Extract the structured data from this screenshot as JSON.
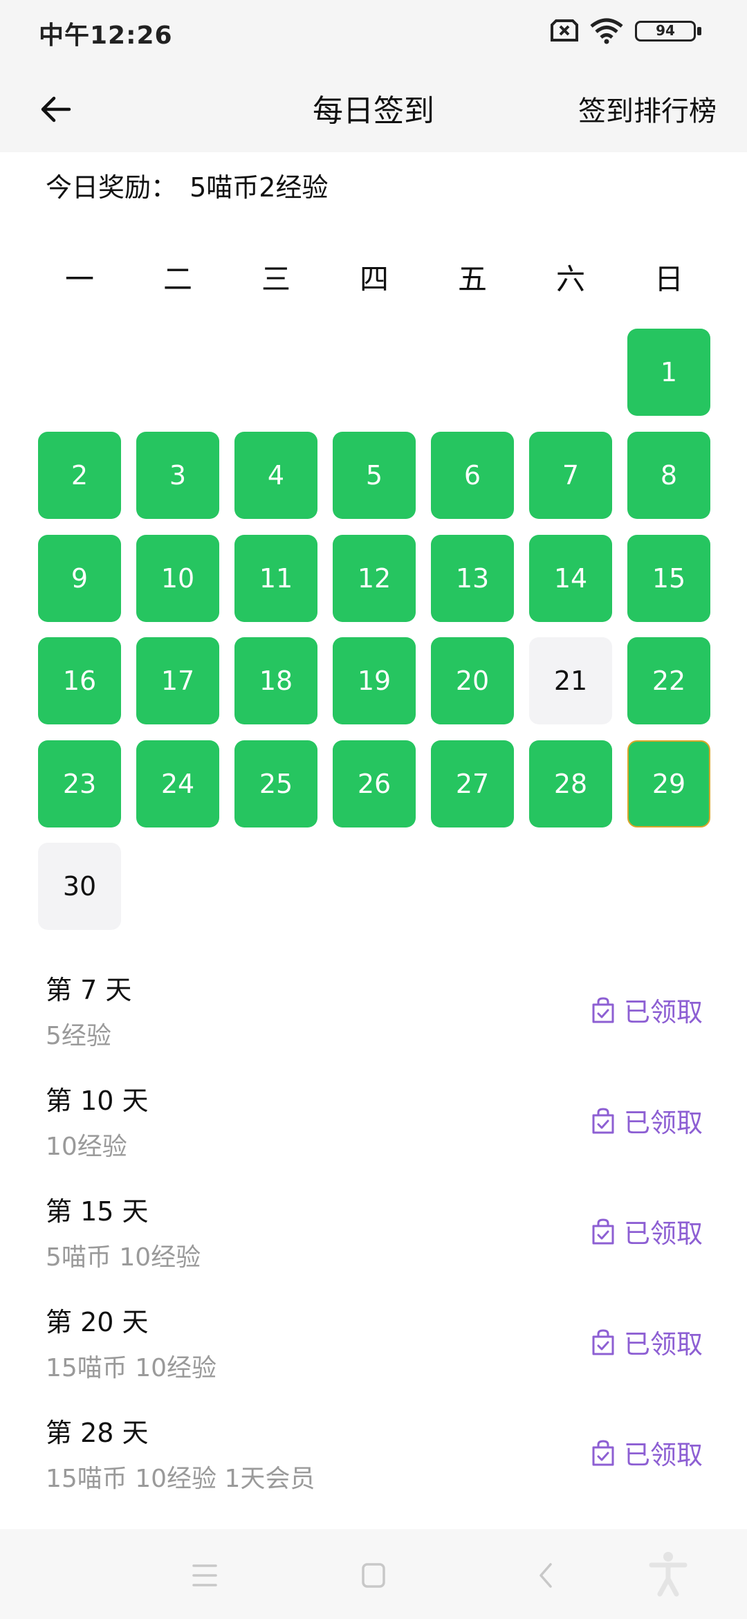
{
  "status_bar": {
    "time": "中午12:26",
    "battery": "94"
  },
  "header": {
    "title": "每日签到",
    "rank_link": "签到排行榜"
  },
  "reward": {
    "label": "今日奖励：",
    "value": "5喵币2经验"
  },
  "weekdays": [
    "一",
    "二",
    "三",
    "四",
    "五",
    "六",
    "日"
  ],
  "calendar": {
    "days": [
      {
        "n": "1",
        "signed": true
      },
      {
        "n": "2",
        "signed": true
      },
      {
        "n": "3",
        "signed": true
      },
      {
        "n": "4",
        "signed": true
      },
      {
        "n": "5",
        "signed": true
      },
      {
        "n": "6",
        "signed": true
      },
      {
        "n": "7",
        "signed": true
      },
      {
        "n": "8",
        "signed": true
      },
      {
        "n": "9",
        "signed": true
      },
      {
        "n": "10",
        "signed": true
      },
      {
        "n": "11",
        "signed": true
      },
      {
        "n": "12",
        "signed": true
      },
      {
        "n": "13",
        "signed": true
      },
      {
        "n": "14",
        "signed": true
      },
      {
        "n": "15",
        "signed": true
      },
      {
        "n": "16",
        "signed": true
      },
      {
        "n": "17",
        "signed": true
      },
      {
        "n": "18",
        "signed": true
      },
      {
        "n": "19",
        "signed": true
      },
      {
        "n": "20",
        "signed": true
      },
      {
        "n": "21",
        "signed": false
      },
      {
        "n": "22",
        "signed": true
      },
      {
        "n": "23",
        "signed": true
      },
      {
        "n": "24",
        "signed": true
      },
      {
        "n": "25",
        "signed": true
      },
      {
        "n": "26",
        "signed": true
      },
      {
        "n": "27",
        "signed": true
      },
      {
        "n": "28",
        "signed": true
      },
      {
        "n": "29",
        "signed": true,
        "today": true
      },
      {
        "n": "30",
        "signed": false
      }
    ]
  },
  "milestones": [
    {
      "title": "第 7 天",
      "desc": "5经验",
      "status": "已领取"
    },
    {
      "title": "第 10 天",
      "desc": "10经验",
      "status": "已领取"
    },
    {
      "title": "第 15 天",
      "desc": "5喵币 10经验",
      "status": "已领取"
    },
    {
      "title": "第 20 天",
      "desc": "15喵币 10经验",
      "status": "已领取"
    },
    {
      "title": "第 28 天",
      "desc": "15喵币 10经验 1天会员",
      "status": "已领取"
    }
  ],
  "colors": {
    "signed": "#26c560",
    "unsigned": "#f3f3f5",
    "claimed": "#8d5fd3",
    "today_border": "#d9a62a"
  }
}
